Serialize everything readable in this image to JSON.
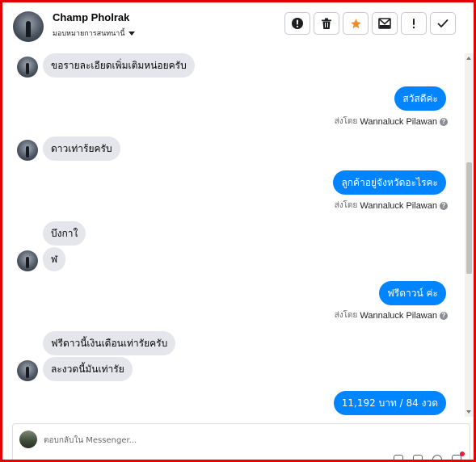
{
  "header": {
    "contact_name": "Champ Pholrak",
    "assign_label": "มอบหมายการสนทนานี้",
    "toolbar": [
      {
        "icon": "alert-circle-icon",
        "label": "mark-spam"
      },
      {
        "icon": "trash-icon",
        "label": "delete"
      },
      {
        "icon": "star-icon",
        "label": "star",
        "color": "#f08a24"
      },
      {
        "icon": "envelope-icon",
        "label": "mark-unread"
      },
      {
        "icon": "exclamation-icon",
        "label": "follow-up"
      },
      {
        "icon": "check-icon",
        "label": "mark-done"
      }
    ]
  },
  "messages": {
    "m1": "ขอรายละเอียดเพิ่มเติมหน่อยครับ",
    "m2": "สวัสดีค่ะ",
    "m3": "ดาวเท่าร้ยครับ",
    "m4": "ลูกค้าอยู่จังหวัดอะไรคะ",
    "m5": "บึงกาใ",
    "m6": "ฬ",
    "m7": "ฟรีดาวน์ ค่ะ",
    "m8": "ฟรีดาวนี้เงินเดือนเท่ารัยครับ",
    "m9": "ละงวดนี้มันเท่ารัย",
    "m10": "11,192 บาท  / 84 งวด"
  },
  "sent_by": {
    "prefix": "ส่งโดย",
    "name": "Wannaluck Pilawan",
    "help": "?"
  },
  "composer": {
    "placeholder": "ตอบกลับใน Messenger..."
  },
  "colors": {
    "outgoing_bubble": "#0084ff",
    "incoming_bubble": "#e4e6eb",
    "frame_border": "#e60000",
    "star": "#f08a24"
  }
}
